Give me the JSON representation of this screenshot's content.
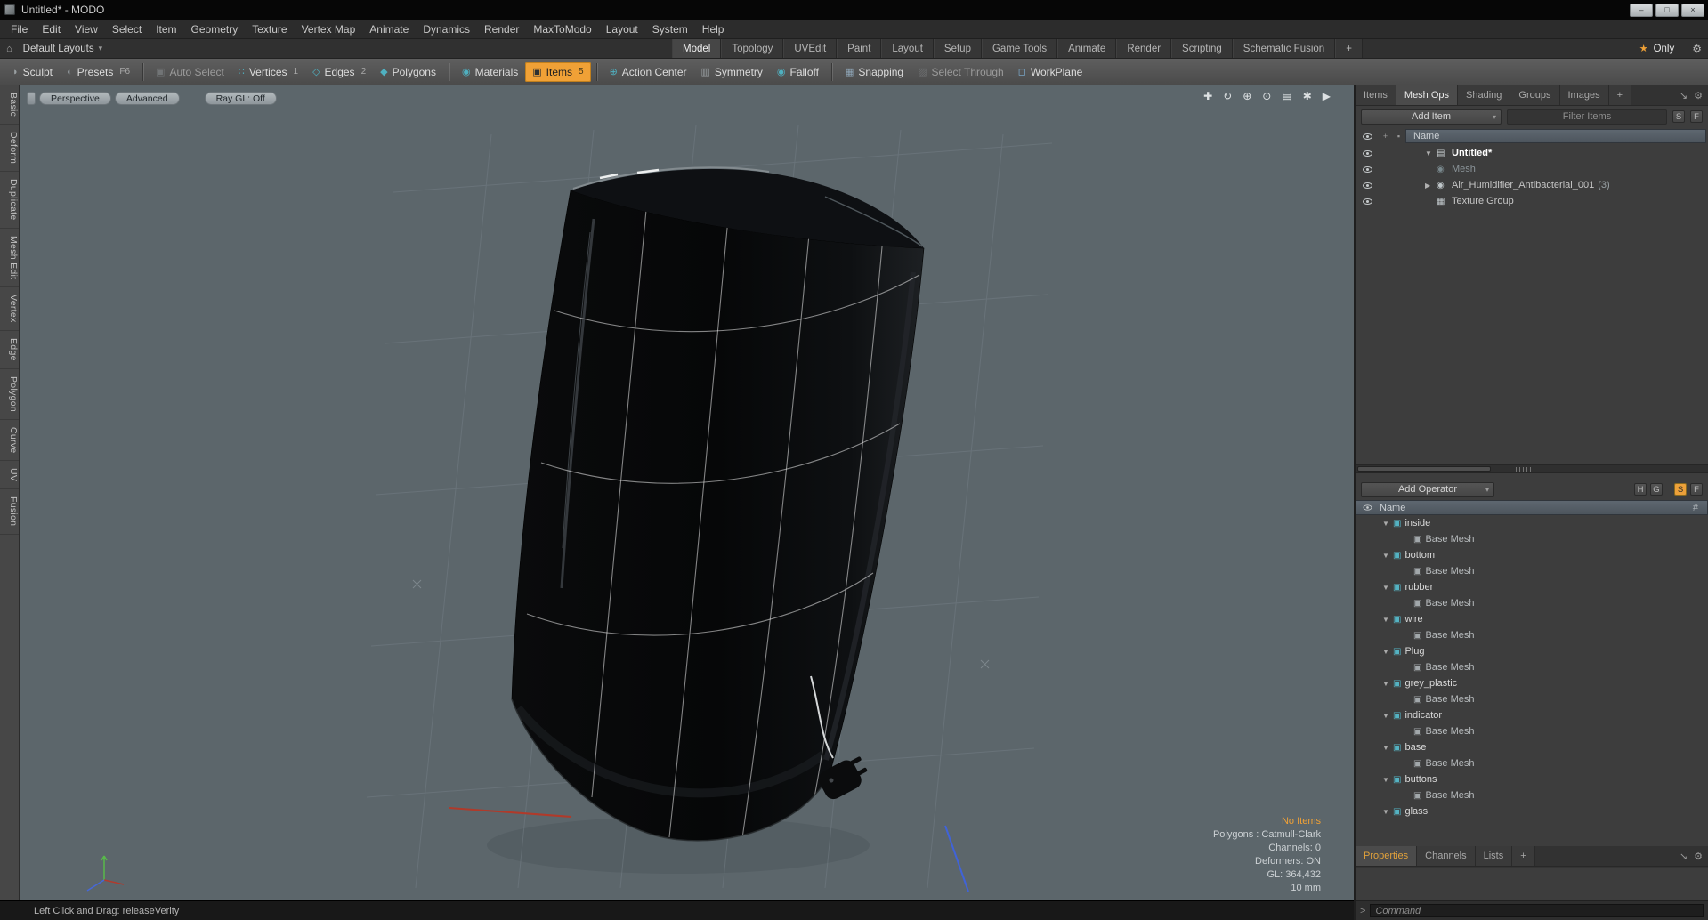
{
  "colors": {
    "accent_orange": "#f0a136",
    "viewport_bg": "#5c666b",
    "teal": "#54b2c2"
  },
  "icons": {
    "caret_down": "▾",
    "star": "★",
    "gear": "⚙",
    "home": "⌂",
    "plus": "+",
    "col2": "▪",
    "expand": "↘",
    "tri_down": "▼",
    "tri_right": "▶",
    "scene": "▤",
    "mesh": "◉",
    "texture": "▦",
    "op": "▣",
    "prompt": ">",
    "minimize": "–",
    "maximize": "□",
    "close": "×"
  },
  "titlebar": {
    "title": "Untitled* - MODO"
  },
  "menubar": {
    "items": [
      "File",
      "Edit",
      "View",
      "Select",
      "Item",
      "Geometry",
      "Texture",
      "Vertex Map",
      "Animate",
      "Dynamics",
      "Render",
      "MaxToModo",
      "Layout",
      "System",
      "Help"
    ]
  },
  "layoutbar": {
    "default_layouts": "Default Layouts",
    "tabs": [
      "Model",
      "Topology",
      "UVEdit",
      "Paint",
      "Layout",
      "Setup",
      "Game Tools",
      "Animate",
      "Render",
      "Scripting",
      "Schematic Fusion",
      "+"
    ],
    "active_tab": "Model",
    "only": "Only"
  },
  "toolbar": {
    "buttons": [
      {
        "name": "sculpt",
        "label": "Sculpt",
        "icon": "sculpt-icon",
        "glyph": "◗",
        "icon_color": "#9aa0a3"
      },
      {
        "name": "presets",
        "label": "Presets",
        "key": "F6",
        "icon": "presets-icon",
        "glyph": "◐",
        "icon_color": "#8d9498"
      },
      {
        "name": "auto-select",
        "label": "Auto Select",
        "icon": "auto-select-icon",
        "glyph": "▣",
        "icon_color": "#8a8f92",
        "disabled": true,
        "group_start": true
      },
      {
        "name": "vertices",
        "label": "Vertices",
        "key": "1",
        "icon": "vertices-icon",
        "glyph": "∷",
        "icon_color": "#4fb0c0"
      },
      {
        "name": "edges",
        "label": "Edges",
        "key": "2",
        "icon": "edges-icon",
        "glyph": "◇",
        "icon_color": "#4fb0c0"
      },
      {
        "name": "polygons",
        "label": "Polygons",
        "icon": "polygons-icon",
        "glyph": "◆",
        "icon_color": "#4fb0c0"
      },
      {
        "name": "materials",
        "label": "Materials",
        "icon": "materials-icon",
        "glyph": "◉",
        "icon_color": "#4fb0c0",
        "group_start": true
      },
      {
        "name": "items",
        "label": "Items",
        "key": "5",
        "icon": "items-icon",
        "glyph": "▣",
        "icon_color": "#2b2b2b",
        "active": true
      },
      {
        "name": "action-center",
        "label": "Action Center",
        "icon": "action-center-icon",
        "glyph": "⊕",
        "icon_color": "#4fb0c0",
        "group_start": true
      },
      {
        "name": "symmetry",
        "label": "Symmetry",
        "icon": "symmetry-icon",
        "glyph": "▥",
        "icon_color": "#9aa0a3"
      },
      {
        "name": "falloff",
        "label": "Falloff",
        "icon": "falloff-icon",
        "glyph": "◉",
        "icon_color": "#4fb0c0"
      },
      {
        "name": "snapping",
        "label": "Snapping",
        "icon": "snapping-icon",
        "glyph": "▦",
        "icon_color": "#8fa6b8",
        "group_start": true
      },
      {
        "name": "select-through",
        "label": "Select Through",
        "icon": "select-through-icon",
        "glyph": "▨",
        "icon_color": "#85898c",
        "disabled": true
      },
      {
        "name": "workplane",
        "label": "WorkPlane",
        "icon": "workplane-icon",
        "glyph": "◻",
        "icon_color": "#7fb2d8"
      }
    ]
  },
  "left_sidebar": {
    "tabs": [
      "Basic",
      "Deform",
      "Duplicate",
      "Mesh Edit",
      "Vertex",
      "Edge",
      "Polygon",
      "Curve",
      "UV",
      "Fusion"
    ]
  },
  "viewport": {
    "buttons": [
      "Perspective",
      "Advanced",
      "Ray GL: Off"
    ],
    "nav_icons": [
      {
        "name": "pan-icon",
        "glyph": "✚"
      },
      {
        "name": "orbit-icon",
        "glyph": "↻"
      },
      {
        "name": "zoom-icon",
        "glyph": "⊕"
      },
      {
        "name": "magnify-icon",
        "glyph": "⊙"
      },
      {
        "name": "graph-icon",
        "glyph": "▤"
      },
      {
        "name": "settings-icon",
        "glyph": "✱"
      },
      {
        "name": "play-icon",
        "glyph": "▶"
      }
    ],
    "status": [
      "No Items",
      "Polygons : Catmull-Clark",
      "Channels: 0",
      "Deformers: ON",
      "GL: 364,432",
      "10 mm"
    ]
  },
  "right_panel": {
    "tabs": [
      "Items",
      "Mesh Ops",
      "Shading",
      "Groups",
      "Images",
      "+"
    ],
    "active_tab": "Mesh Ops",
    "add_item_label": "Add Item",
    "filter_placeholder": "Filter Items",
    "small_buttons": [
      "S",
      "F"
    ],
    "name_header": "Name",
    "tree": [
      {
        "label": "Untitled*",
        "type": "scene",
        "bold": true,
        "disclosure": "down"
      },
      {
        "label": "Mesh",
        "type": "mesh",
        "grayed": true
      },
      {
        "label": "Air_Humidifier_Antibacterial_001",
        "count": "(3)",
        "type": "mesh",
        "disclosure": "right"
      },
      {
        "label": "Texture Group",
        "type": "texture"
      }
    ],
    "add_operator_label": "Add Operator",
    "op_buttons": [
      {
        "label": "H"
      },
      {
        "label": "G"
      },
      {
        "label": "S",
        "active": true
      },
      {
        "label": "F"
      }
    ],
    "op_name_header": "Name",
    "op_hash": "#",
    "operators": [
      {
        "name": "inside",
        "child": "Base Mesh"
      },
      {
        "name": "bottom",
        "child": "Base Mesh"
      },
      {
        "name": "rubber",
        "child": "Base Mesh"
      },
      {
        "name": "wire",
        "child": "Base Mesh"
      },
      {
        "name": "Plug",
        "child": "Base Mesh"
      },
      {
        "name": "grey_plastic",
        "child": "Base Mesh"
      },
      {
        "name": "indicator",
        "child": "Base Mesh"
      },
      {
        "name": "base",
        "child": "Base Mesh"
      },
      {
        "name": "buttons",
        "child": "Base Mesh"
      },
      {
        "name": "glass",
        "child": ""
      }
    ],
    "bottom_tabs": [
      "Properties",
      "Channels",
      "Lists",
      "+"
    ],
    "active_bottom_tab": "Properties",
    "command_placeholder": "Command"
  },
  "statusbar": {
    "hint": "Left Click and Drag:  releaseVerity"
  }
}
